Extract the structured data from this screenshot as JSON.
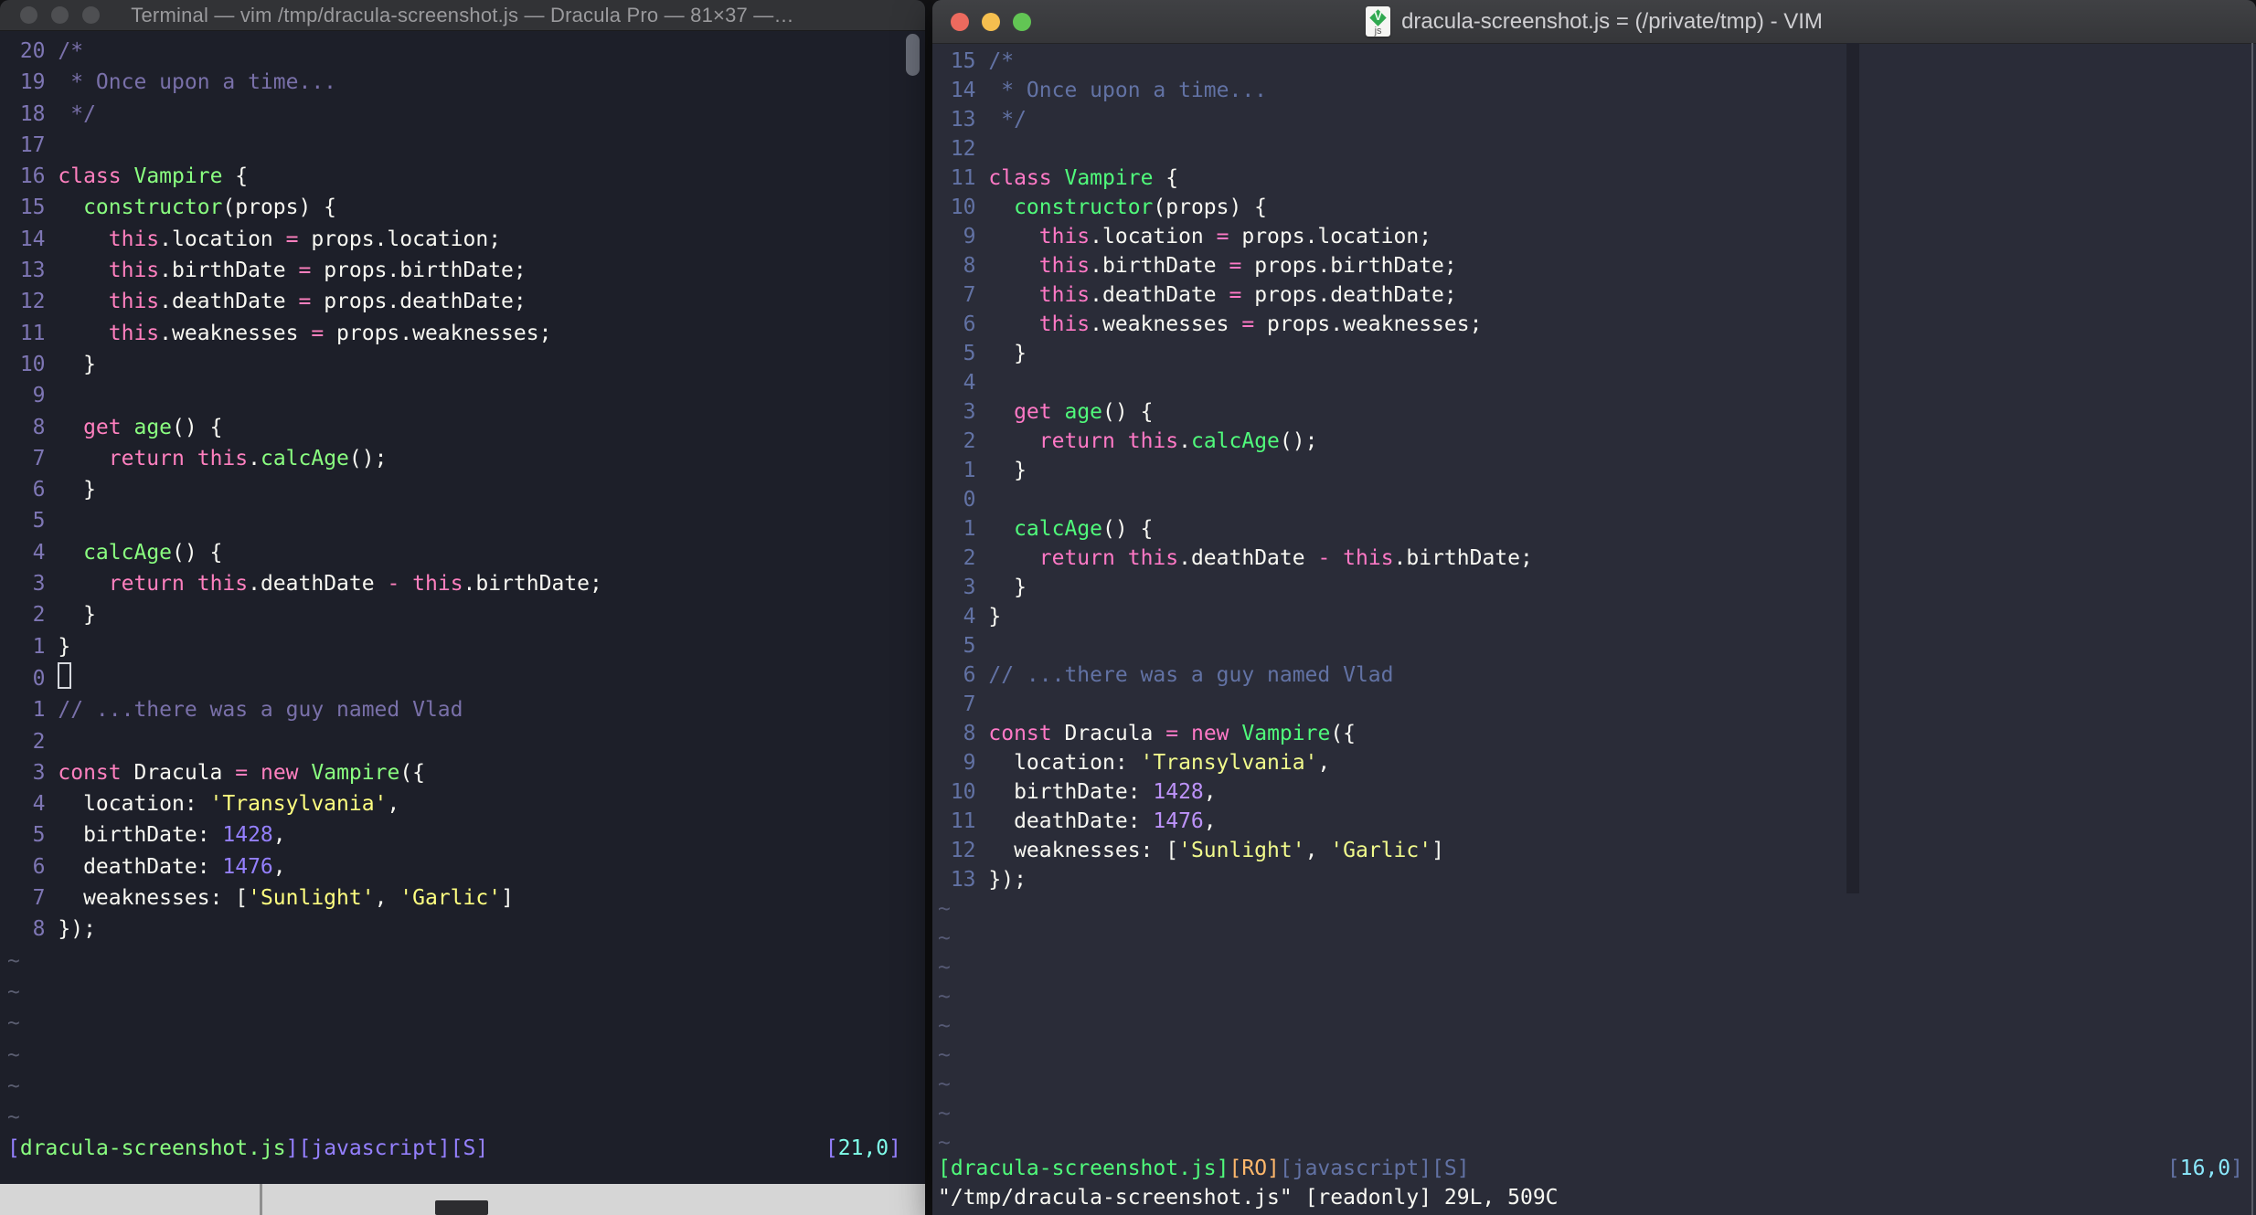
{
  "palette": {
    "left_bg": "#1d1f29",
    "right_bg": "#2a2c38",
    "left_pink": "#ff80bf",
    "left_green": "#8aff80",
    "left_yellow": "#ffff80",
    "left_purple": "#9580ff",
    "left_cyan": "#80ffea",
    "left_comment": "#7970a9",
    "right_pink": "#ff79c6",
    "right_green": "#50fa7b",
    "right_yellow": "#f1fa8c",
    "right_purple": "#bd93f9",
    "right_cyan": "#8be9fd",
    "right_comment": "#6272a4",
    "right_orange": "#ffb86c",
    "foreground": "#f8f8f2",
    "colorcolumn": "#21222c"
  },
  "code_lines": [
    [
      [
        "/*",
        "c"
      ]
    ],
    [
      [
        " * Once upon a time...",
        "c"
      ]
    ],
    [
      [
        " */",
        "c"
      ]
    ],
    [],
    [
      [
        "class",
        "k"
      ],
      [
        " ",
        "w"
      ],
      [
        "Vampire",
        "f"
      ],
      [
        " {",
        "w"
      ]
    ],
    [
      [
        "  ",
        "w"
      ],
      [
        "constructor",
        "f"
      ],
      [
        "(props) {",
        "w"
      ]
    ],
    [
      [
        "    ",
        "w"
      ],
      [
        "this",
        "k"
      ],
      [
        ".location ",
        "w"
      ],
      [
        "=",
        "k"
      ],
      [
        " props.location;",
        "w"
      ]
    ],
    [
      [
        "    ",
        "w"
      ],
      [
        "this",
        "k"
      ],
      [
        ".birthDate ",
        "w"
      ],
      [
        "=",
        "k"
      ],
      [
        " props.birthDate;",
        "w"
      ]
    ],
    [
      [
        "    ",
        "w"
      ],
      [
        "this",
        "k"
      ],
      [
        ".deathDate ",
        "w"
      ],
      [
        "=",
        "k"
      ],
      [
        " props.deathDate;",
        "w"
      ]
    ],
    [
      [
        "    ",
        "w"
      ],
      [
        "this",
        "k"
      ],
      [
        ".weaknesses ",
        "w"
      ],
      [
        "=",
        "k"
      ],
      [
        " props.weaknesses;",
        "w"
      ]
    ],
    [
      [
        "  }",
        "w"
      ]
    ],
    [],
    [
      [
        "  ",
        "w"
      ],
      [
        "get",
        "k"
      ],
      [
        " ",
        "w"
      ],
      [
        "age",
        "f"
      ],
      [
        "() {",
        "w"
      ]
    ],
    [
      [
        "    ",
        "w"
      ],
      [
        "return",
        "k"
      ],
      [
        " ",
        "w"
      ],
      [
        "this",
        "k"
      ],
      [
        ".",
        "w"
      ],
      [
        "calcAge",
        "f"
      ],
      [
        "();",
        "w"
      ]
    ],
    [
      [
        "  }",
        "w"
      ]
    ],
    [],
    [
      [
        "  ",
        "w"
      ],
      [
        "calcAge",
        "f"
      ],
      [
        "() {",
        "w"
      ]
    ],
    [
      [
        "    ",
        "w"
      ],
      [
        "return",
        "k"
      ],
      [
        " ",
        "w"
      ],
      [
        "this",
        "k"
      ],
      [
        ".deathDate ",
        "w"
      ],
      [
        "-",
        "k"
      ],
      [
        " ",
        "w"
      ],
      [
        "this",
        "k"
      ],
      [
        ".birthDate;",
        "w"
      ]
    ],
    [
      [
        "  }",
        "w"
      ]
    ],
    [
      [
        "}",
        "w"
      ]
    ],
    [],
    [
      [
        "// ...there was a guy named Vlad",
        "c"
      ]
    ],
    [],
    [
      [
        "const",
        "k"
      ],
      [
        " Dracula ",
        "w"
      ],
      [
        "=",
        "k"
      ],
      [
        " ",
        "w"
      ],
      [
        "new",
        "k"
      ],
      [
        " ",
        "w"
      ],
      [
        "Vampire",
        "f"
      ],
      [
        "({",
        "w"
      ]
    ],
    [
      [
        "  location: ",
        "w"
      ],
      [
        "'Transylvania'",
        "s"
      ],
      [
        ",",
        "w"
      ]
    ],
    [
      [
        "  birthDate: ",
        "w"
      ],
      [
        "1428",
        "n"
      ],
      [
        ",",
        "w"
      ]
    ],
    [
      [
        "  deathDate: ",
        "w"
      ],
      [
        "1476",
        "n"
      ],
      [
        ",",
        "w"
      ]
    ],
    [
      [
        "  weaknesses: [",
        "w"
      ],
      [
        "'Sunlight'",
        "s"
      ],
      [
        ", ",
        "w"
      ],
      [
        "'Garlic'",
        "s"
      ],
      [
        "]",
        "w"
      ]
    ],
    [
      [
        "});",
        "w"
      ]
    ]
  ],
  "left_window": {
    "title": "Terminal — vim /tmp/dracula-screenshot.js — Dracula Pro — 81×37 —…",
    "numbers": [
      "20",
      "19",
      "18",
      "17",
      "16",
      "15",
      "14",
      "13",
      "12",
      "11",
      "10",
      "9",
      "8",
      "7",
      "6",
      "5",
      "4",
      "3",
      "2",
      "1",
      "0",
      "1",
      "2",
      "3",
      "4",
      "5",
      "6",
      "7",
      "8"
    ],
    "cursor_row": 21,
    "cursor_style": "hollow",
    "tilde_count": 6,
    "statusline": [
      [
        "[",
        "sb"
      ],
      [
        "dracula-screenshot.js",
        "sfile"
      ],
      [
        "]",
        "sb"
      ],
      [
        "[javascript][S]",
        "sb"
      ]
    ],
    "position_indicator": [
      [
        "[",
        "sb"
      ],
      [
        "21,0",
        "spos"
      ],
      [
        "]",
        "sb"
      ]
    ]
  },
  "right_window": {
    "title": "dracula-screenshot.js = (/private/tmp) - VIM",
    "doc_icon_label": "js",
    "numbers": [
      "15",
      "14",
      "13",
      "12",
      "11",
      "10",
      "9",
      "8",
      "7",
      "6",
      "5",
      "4",
      "3",
      "2",
      "1",
      "0",
      "1",
      "2",
      "3",
      "4",
      "5",
      "6",
      "7",
      "8",
      "9",
      "10",
      "11",
      "12",
      "13"
    ],
    "cursor_row": 16,
    "cursor_style": "none",
    "tilde_count": 9,
    "statusline": [
      [
        "[dracula-screenshot.js]",
        "sfile"
      ],
      [
        "[RO]",
        "sro"
      ],
      [
        "[javascript][S]",
        "sb"
      ]
    ],
    "position_indicator": [
      [
        "[",
        "sb"
      ],
      [
        "16,0",
        "spos"
      ],
      [
        "]",
        "sb"
      ]
    ],
    "command_line": "\"/tmp/dracula-screenshot.js\" [readonly] 29L, 509C"
  }
}
